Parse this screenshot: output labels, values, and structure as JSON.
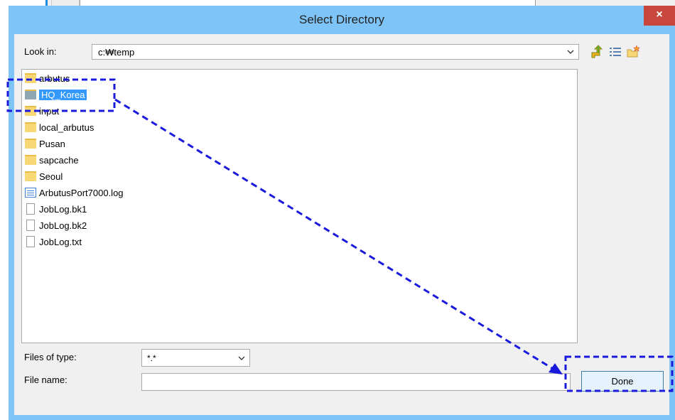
{
  "dialog": {
    "title": "Select Directory",
    "close_glyph": "×"
  },
  "lookin": {
    "label": "Look in:",
    "value": "c:₩temp"
  },
  "toolbar": {
    "icons": [
      "up-folder-icon",
      "list-view-icon",
      "new-folder-icon"
    ]
  },
  "files": [
    {
      "name": "arbutus",
      "type": "folder"
    },
    {
      "name": "HQ_Korea",
      "type": "folder",
      "selected": true
    },
    {
      "name": "input",
      "type": "folder"
    },
    {
      "name": "local_arbutus",
      "type": "folder"
    },
    {
      "name": "Pusan",
      "type": "folder"
    },
    {
      "name": "sapcache",
      "type": "folder"
    },
    {
      "name": "Seoul",
      "type": "folder"
    },
    {
      "name": "ArbutusPort7000.log",
      "type": "log"
    },
    {
      "name": "JobLog.bk1",
      "type": "file"
    },
    {
      "name": "JobLog.bk2",
      "type": "file"
    },
    {
      "name": "JobLog.txt",
      "type": "file"
    }
  ],
  "filetype": {
    "label": "Files of type:",
    "value": "*.*"
  },
  "filename": {
    "label": "File name:",
    "value": ""
  },
  "done_label": "Done",
  "colors": {
    "dialog_frame": "#7fc4f6",
    "close_button": "#c7473c",
    "selection": "#3399ff",
    "annotation": "#1a1adc"
  }
}
